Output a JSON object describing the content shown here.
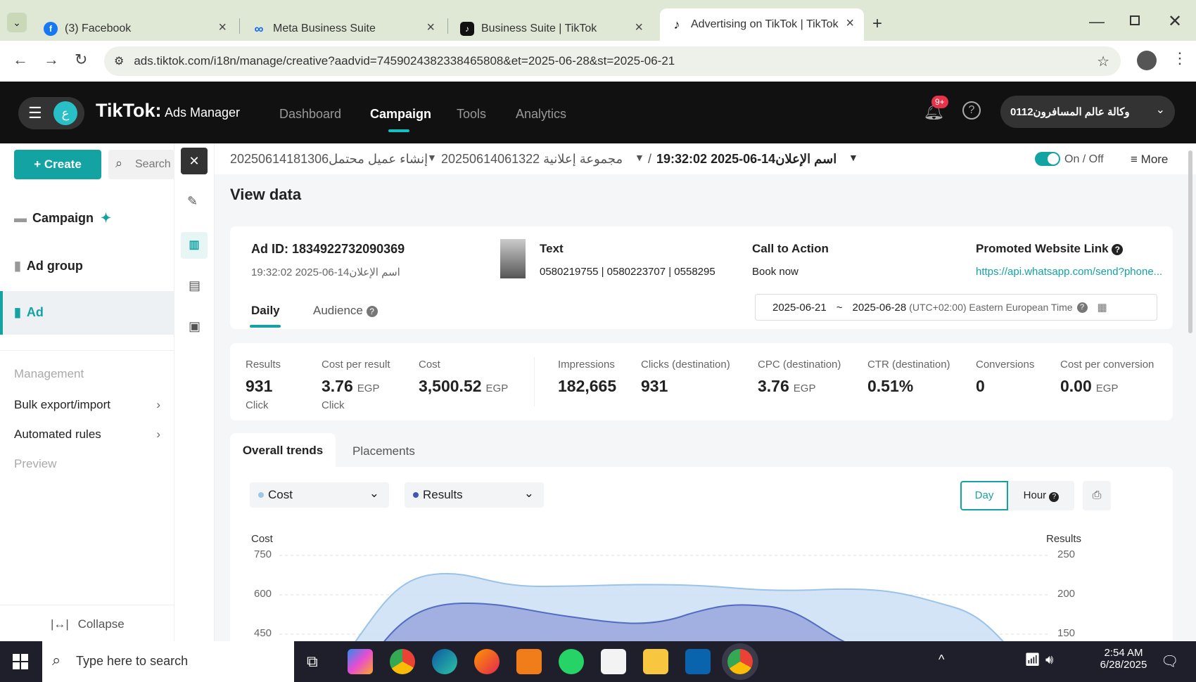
{
  "browser": {
    "tabs": [
      {
        "title": "(3) Facebook"
      },
      {
        "title": "Meta Business Suite"
      },
      {
        "title": "Business Suite | TikTok"
      },
      {
        "title": "Advertising on TikTok | TikTok A"
      }
    ],
    "url": "ads.tiktok.com/i18n/manage/creative?aadvid=7459024382338465808&et=2025-06-28&st=2025-06-21"
  },
  "app": {
    "brand": "TikTok",
    "product": "Ads Manager",
    "nav": [
      "Dashboard",
      "Campaign",
      "Tools",
      "Analytics"
    ],
    "active_nav": "Campaign",
    "notification_badge": "9+",
    "account": "وكالة عالم المسافرون0112"
  },
  "sidebar": {
    "create_label": "+ Create",
    "search_placeholder": "Search",
    "items": [
      {
        "label": "Campaign"
      },
      {
        "label": "Ad group"
      },
      {
        "label": "Ad"
      }
    ],
    "management_heading": "Management",
    "management_items": [
      {
        "label": "Bulk export/import"
      },
      {
        "label": "Automated rules"
      },
      {
        "label": "Preview"
      }
    ],
    "collapse_label": "Collapse"
  },
  "breadcrumb": {
    "campaign": "إنشاء عميل محتمل20250614181306",
    "adgroup": "مجموعة إعلانية 20250614061322",
    "ad": "اسم الإعلان14-06-2025 19:32:02",
    "toggle_label": "On / Off",
    "more_label": "More"
  },
  "view_title": "View data",
  "ad_info": {
    "ad_id": "Ad ID: 1834922732090369",
    "ad_name": "اسم الإعلان14-06-2025 19:32:02",
    "text_heading": "Text",
    "text_value": "0580219755 | 0580223707 | 0558295",
    "cta_heading": "Call to Action",
    "cta_value": "Book now",
    "link_heading": "Promoted Website Link",
    "link_value": "https://api.whatsapp.com/send?phone..."
  },
  "tabs": [
    "Daily",
    "Audience"
  ],
  "date_range": {
    "start": "2025-06-21",
    "sep": "~",
    "end": "2025-06-28",
    "tz": "(UTC+02:00) Eastern European Time"
  },
  "metrics": [
    {
      "label": "Results",
      "value": "931",
      "unit": "",
      "sub": "Click"
    },
    {
      "label": "Cost per result",
      "value": "3.76",
      "unit": "EGP",
      "sub": "Click"
    },
    {
      "label": "Cost",
      "value": "3,500.52",
      "unit": "EGP",
      "sub": ""
    },
    {
      "label": "Impressions",
      "value": "182,665",
      "unit": "",
      "sub": ""
    },
    {
      "label": "Clicks (destination)",
      "value": "931",
      "unit": "",
      "sub": ""
    },
    {
      "label": "CPC (destination)",
      "value": "3.76",
      "unit": "EGP",
      "sub": ""
    },
    {
      "label": "CTR (destination)",
      "value": "0.51%",
      "unit": "",
      "sub": ""
    },
    {
      "label": "Conversions",
      "value": "0",
      "unit": "",
      "sub": ""
    },
    {
      "label": "Cost per conversion",
      "value": "0.00",
      "unit": "EGP",
      "sub": ""
    }
  ],
  "trend_tabs": [
    "Overall trends",
    "Placements"
  ],
  "chart_controls": {
    "metric1": "Cost",
    "metric2": "Results",
    "day": "Day",
    "hour": "Hour"
  },
  "chart_data": {
    "type": "area",
    "ylabel_left": "Cost",
    "ylabel_right": "Results",
    "y_left_ticks": [
      "750",
      "600",
      "450"
    ],
    "y_right_ticks": [
      "250",
      "200",
      "150"
    ]
  },
  "taskbar": {
    "search_placeholder": "Type here to search",
    "time": "2:54 AM",
    "date": "6/28/2025"
  },
  "colors": {
    "accent": "#13a3a3",
    "dark": "#111111"
  }
}
